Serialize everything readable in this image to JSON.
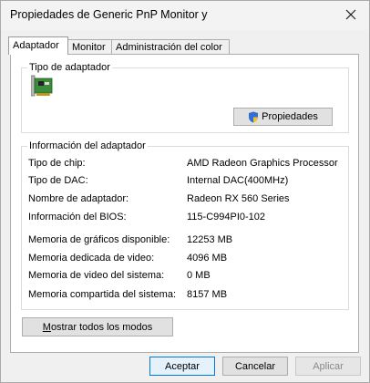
{
  "window": {
    "title": "Propiedades de Generic PnP Monitor y"
  },
  "tabs": [
    {
      "label": "Adaptador"
    },
    {
      "label": "Monitor"
    },
    {
      "label": "Administración del color"
    }
  ],
  "adapter_type": {
    "group_title": "Tipo de adaptador",
    "properties_button": "Propiedades"
  },
  "adapter_info": {
    "group_title": "Información del adaptador",
    "rows": [
      {
        "label": "Tipo de chip:",
        "value": "AMD Radeon Graphics Processor"
      },
      {
        "label": "Tipo de DAC:",
        "value": "Internal DAC(400MHz)"
      },
      {
        "label": "Nombre de adaptador:",
        "value": "Radeon RX 560 Series"
      },
      {
        "label": "Información del BIOS:",
        "value": "115-C994PI0-102"
      }
    ],
    "memory_rows": [
      {
        "label": "Memoria de gráficos disponible:",
        "value": "12253 MB"
      },
      {
        "label": "Memoria dedicada de video:",
        "value": "4096 MB"
      },
      {
        "label": "Memoria de video del sistema:",
        "value": "0 MB"
      },
      {
        "label": "Memoria compartida del sistema:",
        "value": "8157 MB"
      }
    ]
  },
  "list_all_modes_button": {
    "mnemonic": "M",
    "rest": "ostrar todos los modos"
  },
  "footer": {
    "accept": "Aceptar",
    "cancel": "Cancelar",
    "apply": "Aplicar"
  }
}
